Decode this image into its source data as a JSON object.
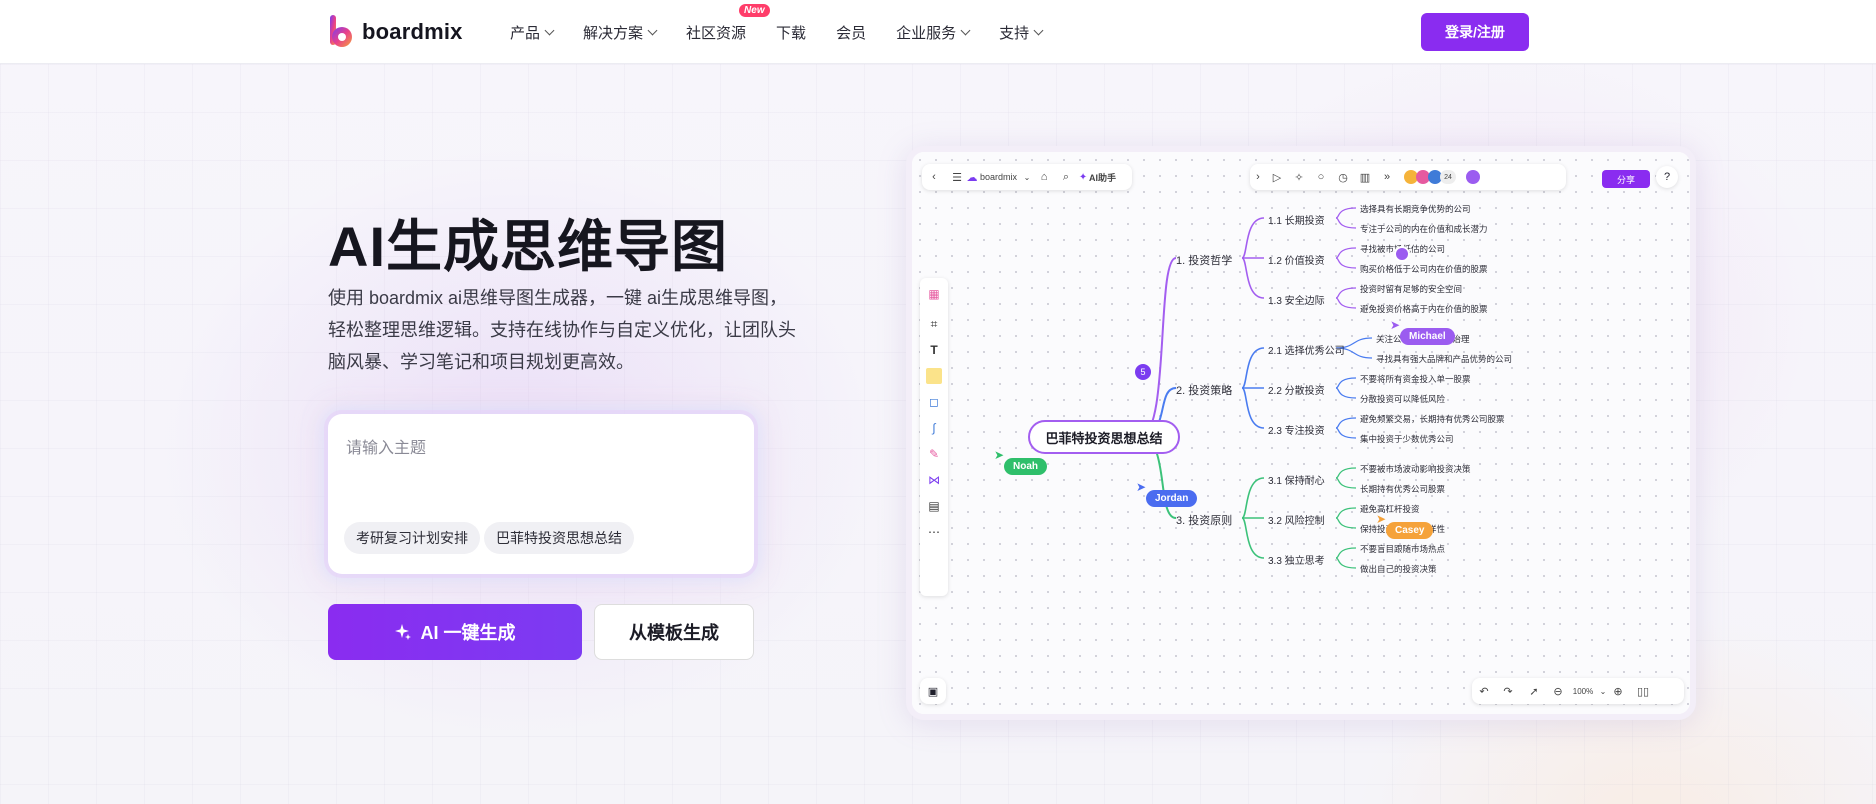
{
  "nav": {
    "brand": "boardmix",
    "items": [
      {
        "label": "产品",
        "has_dropdown": true
      },
      {
        "label": "解决方案",
        "has_dropdown": true
      },
      {
        "label": "社区资源",
        "has_dropdown": false,
        "badge": "New"
      },
      {
        "label": "下载",
        "has_dropdown": false
      },
      {
        "label": "会员",
        "has_dropdown": false
      },
      {
        "label": "企业服务",
        "has_dropdown": true
      },
      {
        "label": "支持",
        "has_dropdown": true
      }
    ],
    "login_label": "登录/注册"
  },
  "hero": {
    "title": "AI生成思维导图",
    "description": "使用 boardmix ai思维导图生成器，一键 ai生成思维导图，轻松整理思维逻辑。支持在线协作与自定义优化，让团队头脑风暴、学习笔记和项目规划更高效。",
    "input_placeholder": "请输入主题",
    "chips": [
      "考研复习计划安排",
      "巴菲特投资思想总结"
    ],
    "ai_button_label": "AI 一键生成",
    "template_button_label": "从模板生成"
  },
  "board": {
    "toolbar": {
      "brand": "boardmix",
      "ai_label": "AI助手",
      "member_count": "24",
      "share_label": "分享",
      "zoom": "100%"
    },
    "root": "巴菲特投资思想总结",
    "branch_badge": "5",
    "branches": [
      {
        "label": "1. 投资哲学",
        "color": "#a35ef0",
        "children": [
          {
            "label": "1.1 长期投资",
            "leaves": [
              "选择具有长期竞争优势的公司",
              "专注于公司的内在价值和成长潜力"
            ]
          },
          {
            "label": "1.2 价值投资",
            "leaves": [
              "寻找被市场低估的公司",
              "购买价格低于公司内在价值的股票"
            ]
          },
          {
            "label": "1.3 安全边际",
            "leaves": [
              "投资时留有足够的安全空间",
              "避免投资价格高于内在价值的股票"
            ]
          }
        ]
      },
      {
        "label": "2. 投资策略",
        "color": "#4a7cf0",
        "children": [
          {
            "label": "2.1 选择优秀公司",
            "leaves": [
              "关注公司的管理层和治理",
              "寻找具有强大品牌和产品优势的公司"
            ]
          },
          {
            "label": "2.2 分散投资",
            "leaves": [
              "不要将所有资金投入单一股票",
              "分散投资可以降低风险"
            ]
          },
          {
            "label": "2.3 专注投资",
            "leaves": [
              "避免频繁交易，长期持有优秀公司股票",
              "集中投资于少数优秀公司"
            ]
          }
        ]
      },
      {
        "label": "3. 投资原则",
        "color": "#3cc27a",
        "children": [
          {
            "label": "3.1 保持耐心",
            "leaves": [
              "不要被市场波动影响投资决策",
              "长期持有优秀公司股票"
            ]
          },
          {
            "label": "3.2 风险控制",
            "leaves": [
              "避免高杠杆投资",
              "保持投资组合的多样性"
            ]
          },
          {
            "label": "3.3 独立思考",
            "leaves": [
              "不要盲目跟随市场热点",
              "做出自己的投资决策"
            ]
          }
        ]
      }
    ],
    "cursors": [
      {
        "name": "Noah",
        "color": "#2fbf6b"
      },
      {
        "name": "Jordan",
        "color": "#4a6cf0"
      },
      {
        "name": "Michael",
        "color": "#9b5cf0"
      },
      {
        "name": "Casey",
        "color": "#f5a23a"
      }
    ]
  }
}
